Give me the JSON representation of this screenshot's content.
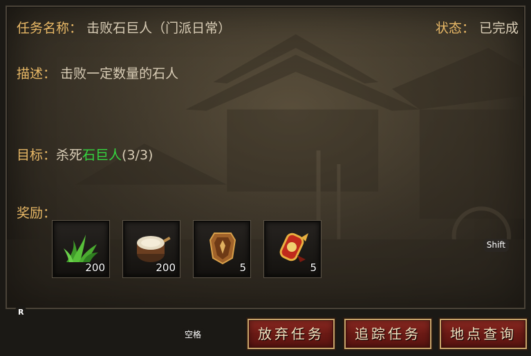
{
  "quest": {
    "name_label": "任务名称：",
    "name_value": "击败石巨人（门派日常）",
    "state_label": "状态：",
    "state_value": "已完成",
    "desc_label": "描述：",
    "desc_value": "击败一定数量的石人",
    "goal_label": "目标：",
    "goal_prefix": "杀死",
    "goal_target": "石巨人",
    "goal_progress": "(3/3)",
    "reward_label": "奖励："
  },
  "rewards": [
    {
      "icon": "herb-grass-icon",
      "count": "200"
    },
    {
      "icon": "drum-icon",
      "count": "200"
    },
    {
      "icon": "bronze-armor-icon",
      "count": "5"
    },
    {
      "icon": "red-scroll-talisman-icon",
      "count": "5"
    }
  ],
  "hints": {
    "shift": "Shift",
    "r": "R",
    "space": "空格"
  },
  "buttons": {
    "abandon": "放弃任务",
    "track": "追踪任务",
    "locate": "地点查询"
  },
  "colors": {
    "label": "#e8b866",
    "value": "#d9cdb6",
    "highlight": "#35d840",
    "button": "#8e2a22"
  }
}
